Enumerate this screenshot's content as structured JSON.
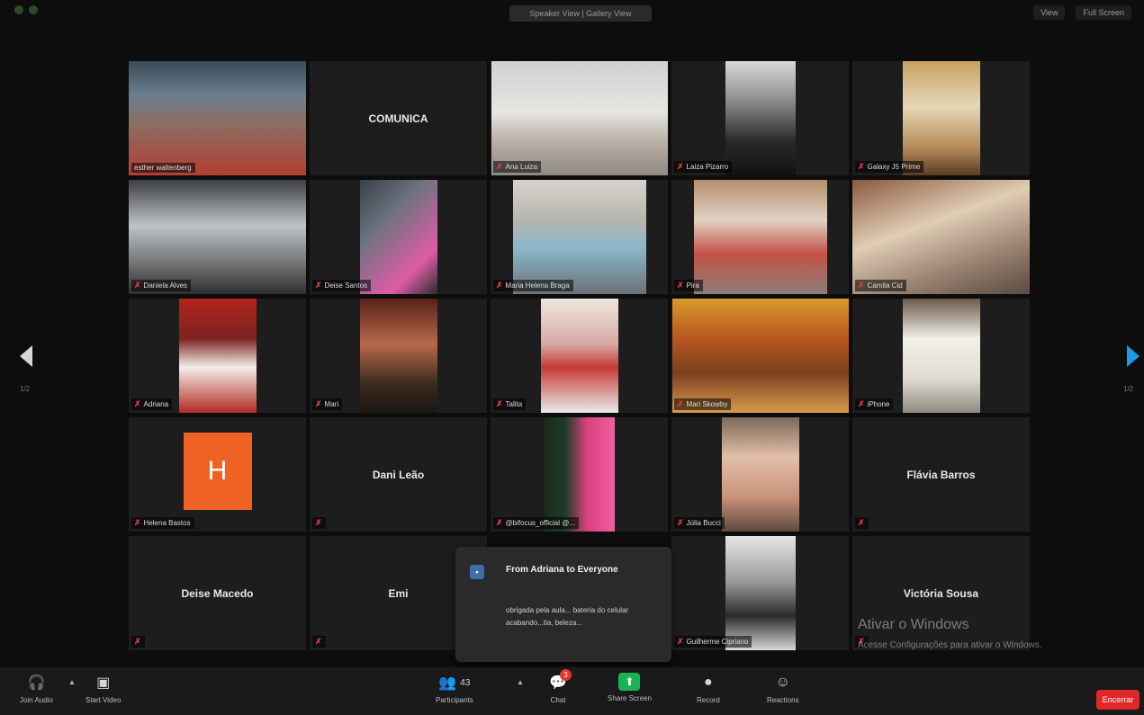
{
  "top_bar": {
    "view_pill": "Speaker View | Gallery View",
    "right_items": [
      "View",
      "Full Screen"
    ]
  },
  "gallery": {
    "tiles": [
      {
        "name": "esther waltenberg",
        "muted": false,
        "active": true
      },
      {
        "name": "COMUNICA",
        "muted": false,
        "active": false
      },
      {
        "name": "Ana Luiza",
        "muted": true,
        "active": false
      },
      {
        "name": "Laiza Pizarro",
        "muted": true,
        "active": false
      },
      {
        "name": "Galaxy J5 Prime",
        "muted": true,
        "active": false
      },
      {
        "name": "Daniela Alves",
        "muted": true,
        "active": false
      },
      {
        "name": "Deise Santos",
        "muted": true,
        "active": false
      },
      {
        "name": "Maria Helena Braga",
        "muted": true,
        "active": false
      },
      {
        "name": "Pira",
        "muted": true,
        "active": false
      },
      {
        "name": "Camila Cid",
        "muted": true,
        "active": false
      },
      {
        "name": "Adriana",
        "muted": true,
        "active": false
      },
      {
        "name": "Mari",
        "muted": true,
        "active": false
      },
      {
        "name": "Talita",
        "muted": true,
        "active": false
      },
      {
        "name": "Mari Skowby",
        "muted": true,
        "active": false
      },
      {
        "name": "iPhone",
        "muted": true,
        "active": false
      },
      {
        "name": "Helena Bastos",
        "muted": true,
        "active": false,
        "avatar_letter": "H"
      },
      {
        "name": "Dani Leão",
        "muted": true,
        "active": false
      },
      {
        "name": "@bifocus_official @...",
        "muted": true,
        "active": false
      },
      {
        "name": "Júlia Bucci",
        "muted": true,
        "active": false
      },
      {
        "name": "Flávia Barros",
        "muted": true,
        "active": false
      },
      {
        "name": "Deise Macedo",
        "muted": true,
        "active": false
      },
      {
        "name": "Emi",
        "muted": true,
        "active": false
      },
      {
        "name": "Guilherme Cipriano",
        "muted": true,
        "active": false
      },
      {
        "name": "Victória Sousa",
        "muted": true,
        "active": false
      }
    ],
    "page_left": "1/2",
    "page_right": "1/2"
  },
  "chat_popup": {
    "title": "From Adriana to Everyone",
    "message": "obrigada pela aula... bateria do celular acabando...tia, beleza..."
  },
  "watermark": {
    "line1": "Ativar o Windows",
    "line2": "Acesse Configurações para ativar o Windows."
  },
  "toolbar": {
    "join_audio": "Join Audio",
    "start_video": "Start Video",
    "participants": "Participants",
    "participants_count": "43",
    "chat": "Chat",
    "chat_badge": "3",
    "share_screen": "Share Screen",
    "record": "Record",
    "reactions": "Reactions",
    "end": "Encerrar"
  }
}
